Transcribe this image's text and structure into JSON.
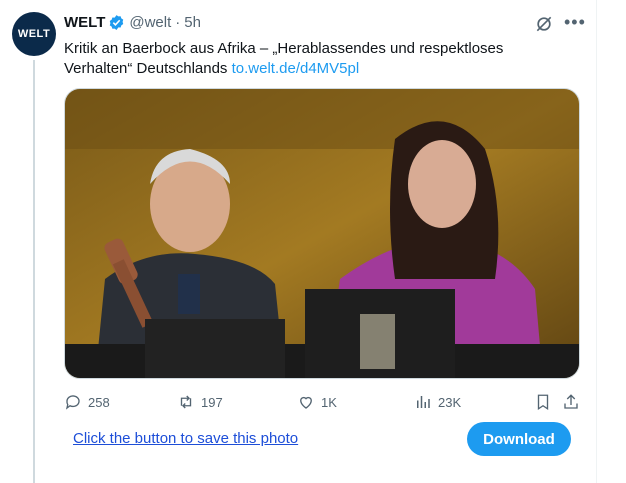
{
  "tweet": {
    "avatar_text": "WELT",
    "author_name": "WELT",
    "handle": "@welt",
    "separator": "·",
    "time": "5h",
    "text": "Kritik an Baerbock aus Afrika – „Herablassendes und respektloses Verhalten“ Deutschlands ",
    "link": "to.welt.de/d4MV5pl"
  },
  "actions": {
    "replies": "258",
    "reposts": "197",
    "likes": "1K",
    "views": "23K"
  },
  "footer": {
    "save_text": "Click the button to save this photo",
    "download_label": "Download"
  },
  "colors": {
    "accent": "#1d9bf0",
    "link_blue": "#1d4ed8",
    "muted": "#536471"
  }
}
